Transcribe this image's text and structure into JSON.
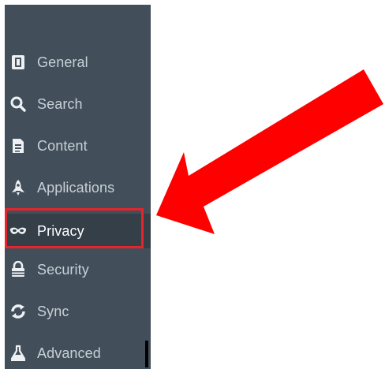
{
  "sidebar": {
    "items": [
      {
        "label": "General",
        "icon": "general-icon"
      },
      {
        "label": "Search",
        "icon": "search-icon"
      },
      {
        "label": "Content",
        "icon": "content-icon"
      },
      {
        "label": "Applications",
        "icon": "applications-icon"
      },
      {
        "label": "Privacy",
        "icon": "privacy-mask-icon",
        "selected": true
      },
      {
        "label": "Security",
        "icon": "security-lock-icon"
      },
      {
        "label": "Sync",
        "icon": "sync-icon"
      },
      {
        "label": "Advanced",
        "icon": "advanced-icon"
      }
    ]
  },
  "annotation": {
    "highlight_color": "#e5242b",
    "arrow_color": "#ff0000",
    "target": "Privacy"
  },
  "colors": {
    "sidebar_bg": "#424f5a",
    "selected_bg": "#343f48",
    "label": "#c8cfd6"
  }
}
